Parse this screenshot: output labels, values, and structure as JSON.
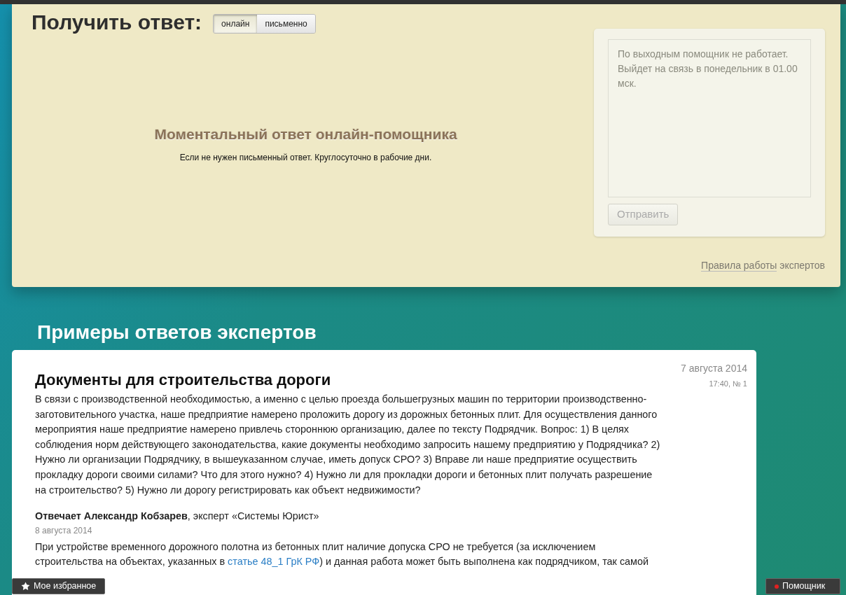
{
  "ask": {
    "title": "Получить ответ:",
    "modes": [
      {
        "label": "онлайн",
        "selected": true
      },
      {
        "label": "письменно",
        "selected": false
      }
    ],
    "online_heading": "Моментальный ответ онлайн-помощника",
    "online_note": "Если не нужен письменный ответ. Круглосуточно в рабочие дни.",
    "chat": {
      "message": "По выходным помощник не работает. Выйдет на связь в понедельник в 01.00 мск.",
      "send_button": {
        "label": "Отправить",
        "disabled": true
      }
    },
    "rules": {
      "link": "Правила работы",
      "rest": "экспертов"
    }
  },
  "examples": {
    "heading": "Примеры ответов экспертов",
    "items": [
      {
        "date": "7 августа 2014",
        "time": "17:40, № 1",
        "title": "Документы для строительства дороги",
        "question": "В связи с производственной необходимостью, а именно с целью проезда большегрузных машин по территории производственно-заготовительного участка, наше предприятие намерено проложить дорогу из дорожных бетонных плит. Для осуществления данного мероприятия наше предприятие намерено привлечь стороннюю организацию, далее по тексту Подрядчик. Вопрос: 1) В целях соблюдения норм действующего законодательства, какие документы необходимо запросить нашему предприятию у Подрядчика? 2) Нужно ли организации Подрядчику, в вышеуказанном случае, иметь допуск СРО? 3) Вправе ли наше предприятие осуществить прокладку дороги своими силами? Что для этого нужно? 4) Нужно ли для прокладки дороги и бетонных плит получать разрешение на строительство? 5) Нужно ли дорогу регистрировать как объект недвижимости?",
        "author": "**Отвечает Александр Кобзарев**, эксперт «Системы Юрист»",
        "answer_date": "8 августа 2014",
        "answer": {
          "before": "При устройстве временного дорожного полотна из бетонных плит наличие допуска СРО не требуется (за исключением строительства на объектах, указанных в",
          "link": "статье 48_1 ГрК РФ",
          "after": ") и данная работа может быть выполнена как подрядчиком, так самой"
        }
      }
    ]
  },
  "floating": {
    "favorites": {
      "label": "Мое избранное"
    },
    "helper": {
      "label": "Помощник",
      "online": false
    }
  }
}
